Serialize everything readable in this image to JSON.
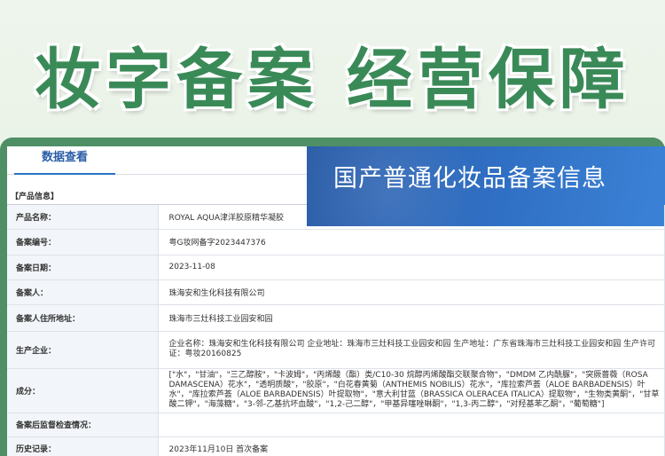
{
  "headline": "妆字备案 经营保障",
  "tab": {
    "label": "数据查看"
  },
  "banner": {
    "title": "国产普通化妆品备案信息"
  },
  "section": {
    "title": "【产品信息】"
  },
  "rows": [
    {
      "label": "产品名称：",
      "value": "ROYAL AQUA津洋胶原精华凝胶"
    },
    {
      "label": "备案编号：",
      "value": "粤G妆网备字2023447376"
    },
    {
      "label": "备案日期：",
      "value": "2023-11-08"
    },
    {
      "label": "备案人：",
      "value": "珠海安和生化科技有限公司"
    },
    {
      "label": "备案人住所地址：",
      "value": "珠海市三灶科技工业园安和园"
    },
    {
      "label": "生产企业：",
      "value": "企业名称：珠海安和生化科技有限公司 企业地址：珠海市三灶科技工业园安和园 生产地址：广东省珠海市三灶科技工业园安和园 生产许可证：粤妆20160825"
    },
    {
      "label": "成分：",
      "value": "[\"水\"，\"甘油\"，\"三乙醇胺\"，\"卡波姆\"，\"丙烯酸（酯）类/C10-30 烷醇丙烯酸酯交联聚合物\"，\"DMDM 乙内酰脲\"，\"突厥蔷薇（ROSA DAMASCENA）花水\"，\"透明质酸\"，\"胶原\"，\"白花春黄菊（ANTHEMIS NOBILIS）花水\"，\"库拉索芦荟（ALOE BARBADENSIS）叶水\"，\"库拉索芦荟（ALOE BARBADENSIS）叶提取物\"，\"意大利甘蓝（BRASSICA OLERACEA ITALICA）提取物\"，\"生物类黄酮\"，\"甘草酸二钾\"，\"海藻糖\"，\"3-邻-乙基抗坏血酸\"，\"1,2-己二醇\"，\"甲基异噻唑啉酮\"，\"1,3-丙二醇\"，\"对羟基苯乙酮\"，\"葡萄糖\"]"
    },
    {
      "label": "备案后监督检查情况：",
      "value": ""
    },
    {
      "label": "历史记录：",
      "value": "2023年11月10日 首次备案"
    }
  ]
}
